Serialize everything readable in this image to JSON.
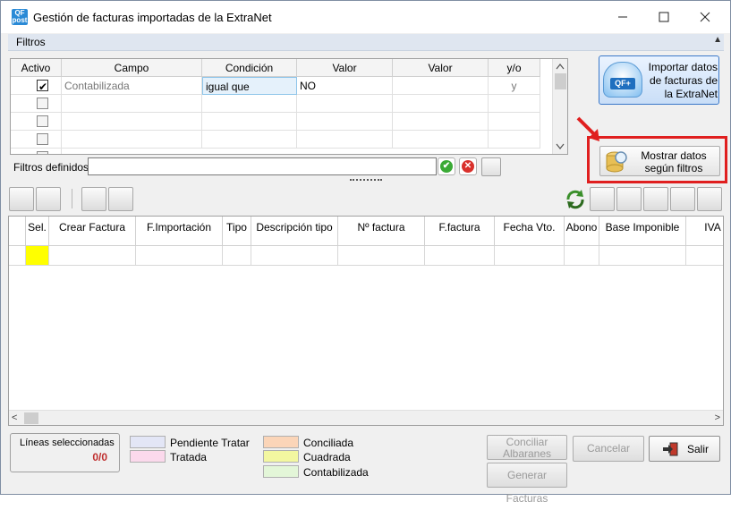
{
  "window": {
    "title": "Gestión de facturas importadas de la ExtraNet",
    "icon_text": "QF\npost",
    "controls": [
      "minimize",
      "maximize",
      "close"
    ]
  },
  "filtros": {
    "label": "Filtros",
    "columns": [
      "Activo",
      "Campo",
      "Condición",
      "Valor",
      "Valor",
      "y/o"
    ],
    "rows": [
      {
        "activo": true,
        "campo": "Contabilizada",
        "condicion": "igual que",
        "valor1": "NO",
        "valor2": "",
        "yo": "y"
      },
      {
        "activo": false,
        "campo": "",
        "condicion": "",
        "valor1": "",
        "valor2": "",
        "yo": ""
      },
      {
        "activo": false,
        "campo": "",
        "condicion": "",
        "valor1": "",
        "valor2": "",
        "yo": ""
      },
      {
        "activo": false,
        "campo": "",
        "condicion": "",
        "valor1": "",
        "valor2": "",
        "yo": ""
      },
      {
        "activo": false,
        "campo": "",
        "condicion": "",
        "valor1": "",
        "valor2": "",
        "yo": ""
      }
    ],
    "definidos_label": "Filtros definidos:",
    "definidos_value": ""
  },
  "actions": {
    "import_label": "Importar datos de facturas de la ExtraNet",
    "import_icon_text": "QF+",
    "show_label": "Mostrar datos según filtros"
  },
  "main_grid": {
    "columns": [
      "Sel.",
      "Crear Factura",
      "F.Importación",
      "Tipo",
      "Descripción tipo",
      "Nº factura",
      "F.factura",
      "Fecha Vto.",
      "Abono",
      "Base Imponible",
      "IVA"
    ]
  },
  "footer": {
    "lines_label": "Líneas seleccionadas",
    "lines_count": "0/0",
    "legend": [
      {
        "label": "Pendiente Tratar",
        "color": "#e3e6f6"
      },
      {
        "label": "Tratada",
        "color": "#fbd9ec"
      },
      {
        "label": "Conciliada",
        "color": "#fbd5b8"
      },
      {
        "label": "Cuadrada",
        "color": "#f3f7a0"
      },
      {
        "label": "Contabilizada",
        "color": "#e3f6d8"
      }
    ],
    "conciliar_label": "Conciliar Albaranes",
    "generar_label": "Generar Facturas",
    "cancelar_label": "Cancelar",
    "salir_label": "Salir"
  },
  "colors": {
    "highlight": "#e01f1f",
    "selected_cell": "#ffff00",
    "header_bar": "#dfe6f0"
  }
}
